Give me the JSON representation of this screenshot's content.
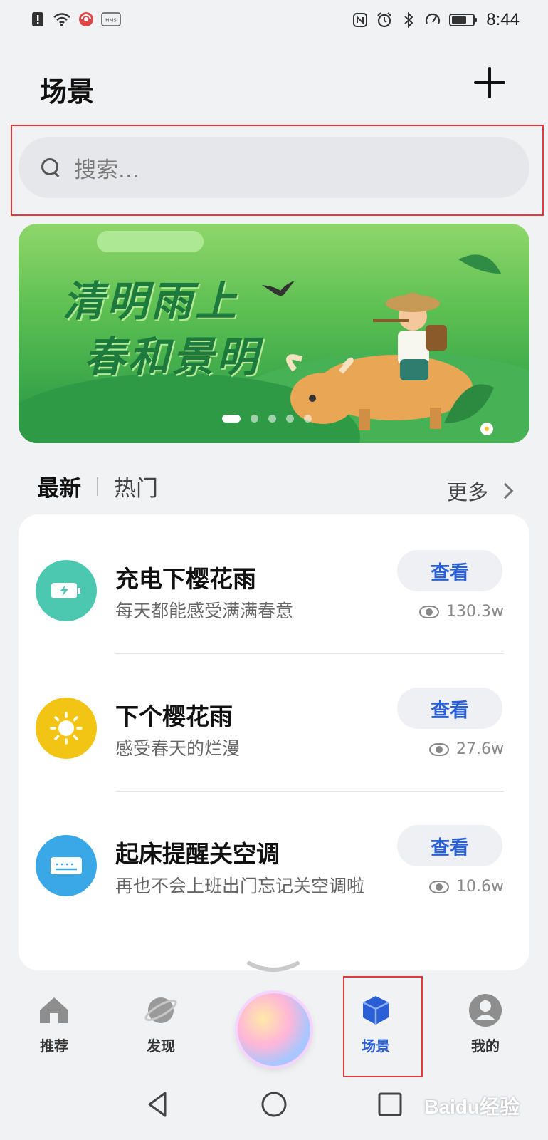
{
  "status_bar": {
    "left_icons": [
      "alert-icon",
      "wifi-icon",
      "hotspot-icon",
      "hms-icon"
    ],
    "hms_label": "HMS",
    "right_icons": [
      "nfc-icon",
      "alarm-icon",
      "bluetooth-icon",
      "speedometer-icon",
      "battery-icon"
    ],
    "time": "8:44"
  },
  "header": {
    "title": "场景",
    "add_icon": "plus-icon"
  },
  "search": {
    "placeholder": "搜索..."
  },
  "banner": {
    "line1": "清明雨上",
    "line2": "春和景明",
    "pages": 5,
    "active_page": 1
  },
  "tabs": {
    "latest": "最新",
    "popular": "热门",
    "more": "更多"
  },
  "scenes": [
    {
      "title": "充电下樱花雨",
      "subtitle": "每天都能感受满满春意",
      "button": "查看",
      "views": "130.3w",
      "icon": "battery-charging-icon",
      "color": "#4cc7b0"
    },
    {
      "title": "下个樱花雨",
      "subtitle": "感受春天的烂漫",
      "button": "查看",
      "views": "27.6w",
      "icon": "sun-icon",
      "color": "#f2c414"
    },
    {
      "title": "起床提醒关空调",
      "subtitle": "再也不会上班出门忘记关空调啦",
      "button": "查看",
      "views": "10.6w",
      "icon": "air-conditioner-icon",
      "color": "#3aa7e6"
    }
  ],
  "bottom_nav": {
    "items": [
      {
        "label": "推荐",
        "icon": "home-icon"
      },
      {
        "label": "发现",
        "icon": "planet-icon"
      },
      {
        "label": "场景",
        "icon": "cube-icon",
        "active": true
      },
      {
        "label": "我的",
        "icon": "person-icon"
      }
    ],
    "accent": "#2a5fd6"
  },
  "watermark": "Baidu经验"
}
